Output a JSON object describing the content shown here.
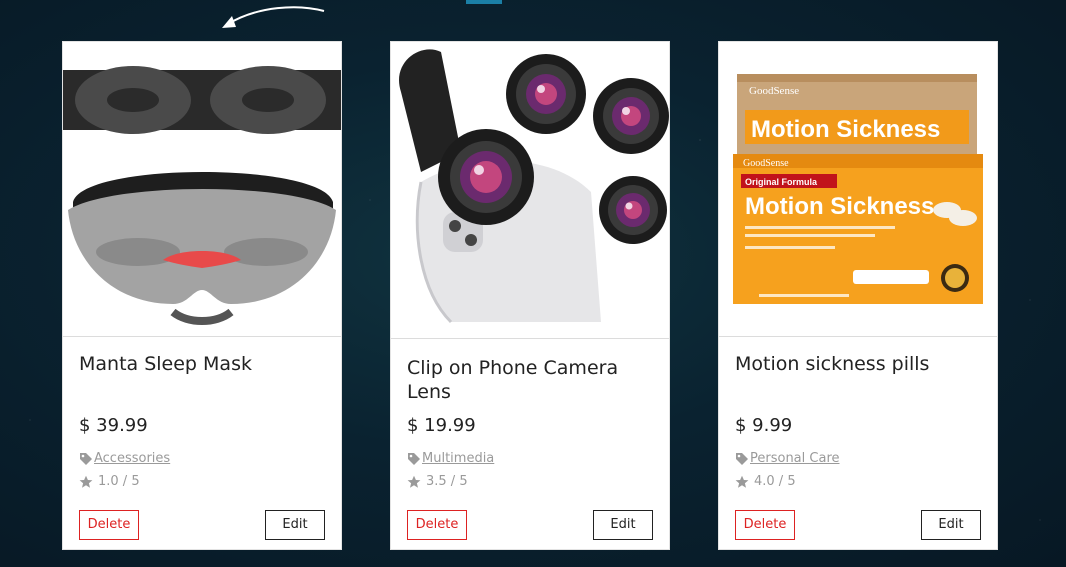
{
  "products": [
    {
      "title": "Manta Sleep Mask",
      "price": "$ 39.99",
      "category": "Accessories",
      "rating": "1.0 / 5",
      "delete_label": "Delete",
      "edit_label": "Edit"
    },
    {
      "title": "Clip on Phone Camera Lens",
      "price": "$ 19.99",
      "category": "Multimedia",
      "rating": "3.5 / 5",
      "delete_label": "Delete",
      "edit_label": "Edit"
    },
    {
      "title": "Motion sickness pills",
      "price": "$ 9.99",
      "category": "Personal Care",
      "rating": "4.0 / 5",
      "delete_label": "Delete",
      "edit_label": "Edit"
    }
  ],
  "pill_box": {
    "brand": "GoodSense",
    "product_name": "Motion Sickness",
    "subtitle": "Original Formula"
  },
  "icons": {
    "category": "tag-icon",
    "rating": "star-icon",
    "arrow": "curved-arrow-icon"
  },
  "colors": {
    "delete": "#dd2222",
    "accent_tab": "#1b7fa6",
    "pill_orange": "#f29a1a"
  }
}
